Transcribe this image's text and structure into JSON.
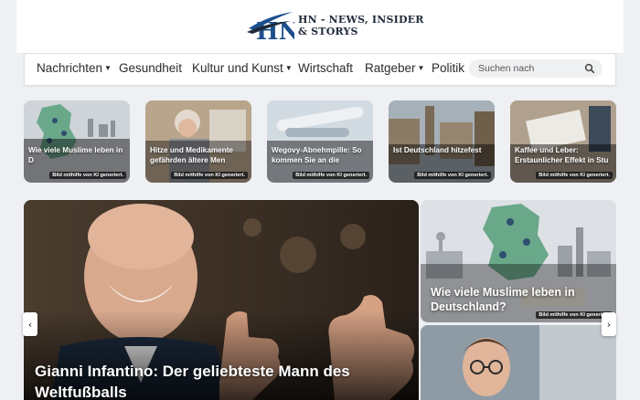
{
  "site": {
    "logo_letters": "HN",
    "logo_line1": "HN - NEWS, INSIDER",
    "logo_line2": "& STORYS"
  },
  "nav": {
    "items": [
      {
        "label": "Nachrichten",
        "has_dropdown": true
      },
      {
        "label": "Gesundheit",
        "has_dropdown": false
      },
      {
        "label": "Kultur und Kunst",
        "has_dropdown": true
      },
      {
        "label": "Wirtschaft",
        "has_dropdown": false
      },
      {
        "label": "Ratgeber",
        "has_dropdown": true
      },
      {
        "label": "Politik",
        "has_dropdown": false
      }
    ],
    "search_placeholder": "Suchen nach"
  },
  "cards": [
    {
      "title": "Wie viele Muslime leben in D",
      "badge": "Bild mithilfe von KI generiert."
    },
    {
      "title": "Hitze und Medikamente gefährden ältere Men",
      "badge": "Bild mithilfe von KI generiert."
    },
    {
      "title": "Wegovy-Abnehmpille: So kommen Sie an die",
      "badge": "Bild mithilfe von KI generiert."
    },
    {
      "title": "Ist Deutschland hitzefest",
      "badge": "Bild mithilfe von KI generiert."
    },
    {
      "title": "Kaffee und Leber: Erstaunlicher Effekt in Stu",
      "badge": "Bild mithilfe von KI generiert."
    }
  ],
  "hero": {
    "title": "Gianni Infantino: Der geliebteste Mann des Weltfußballs"
  },
  "side": {
    "title": "Wie viele Muslime leben in Deutschland?",
    "badge": "Bild mithilfe von KI generiert."
  },
  "controls": {
    "prev": "‹",
    "next": "›"
  },
  "colors": {
    "accent_blue": "#1d4f8c",
    "dark_navy": "#1f2a3a",
    "map_green": "#6aa88a"
  }
}
